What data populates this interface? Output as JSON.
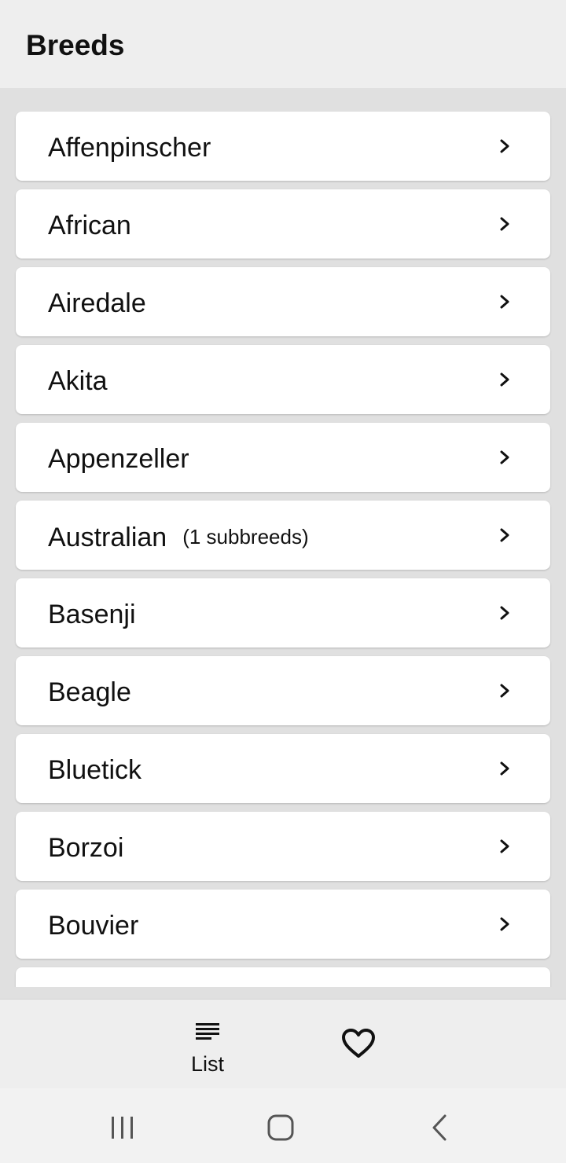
{
  "app_bar": {
    "title": "Breeds"
  },
  "breeds": [
    {
      "name": "Affenpinscher",
      "sub": ""
    },
    {
      "name": "African",
      "sub": ""
    },
    {
      "name": "Airedale",
      "sub": ""
    },
    {
      "name": "Akita",
      "sub": ""
    },
    {
      "name": "Appenzeller",
      "sub": ""
    },
    {
      "name": "Australian",
      "sub": "(1 subbreeds)"
    },
    {
      "name": "Basenji",
      "sub": ""
    },
    {
      "name": "Beagle",
      "sub": ""
    },
    {
      "name": "Bluetick",
      "sub": ""
    },
    {
      "name": "Borzoi",
      "sub": ""
    },
    {
      "name": "Bouvier",
      "sub": ""
    },
    {
      "name": "",
      "sub": ""
    }
  ],
  "bottom_nav": {
    "list_label": "List",
    "list_icon": "list-icon",
    "favorites_icon": "heart-icon"
  },
  "system_nav": {
    "recent_icon": "recent-apps-icon",
    "home_icon": "home-icon",
    "back_icon": "back-icon"
  },
  "colors": {
    "app_bar_bg": "#eeeeee",
    "list_bg": "#e0e0e0",
    "card_bg": "#ffffff",
    "text": "#111111"
  }
}
